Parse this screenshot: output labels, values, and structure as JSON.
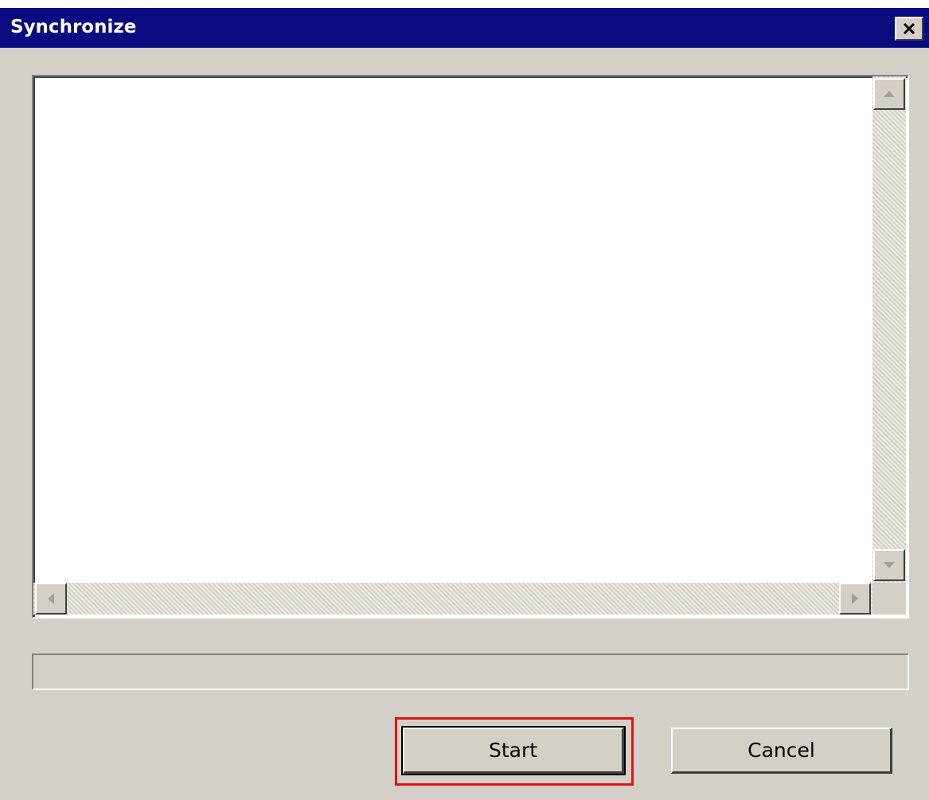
{
  "window": {
    "title": "Synchronize",
    "close_label": "Close"
  },
  "log": {
    "text": ""
  },
  "progress": {
    "value": 0
  },
  "buttons": {
    "start_label": "Start",
    "cancel_label": "Cancel"
  },
  "icons": {
    "close": "close-icon",
    "scroll_up": "scroll-up-arrow-icon",
    "scroll_down": "scroll-down-arrow-icon",
    "scroll_left": "scroll-left-arrow-icon",
    "scroll_right": "scroll-right-arrow-icon"
  },
  "colors": {
    "titlebar": "#0a0a80",
    "dialog_face": "#d4d0c8",
    "focus_highlight": "#e41010"
  }
}
